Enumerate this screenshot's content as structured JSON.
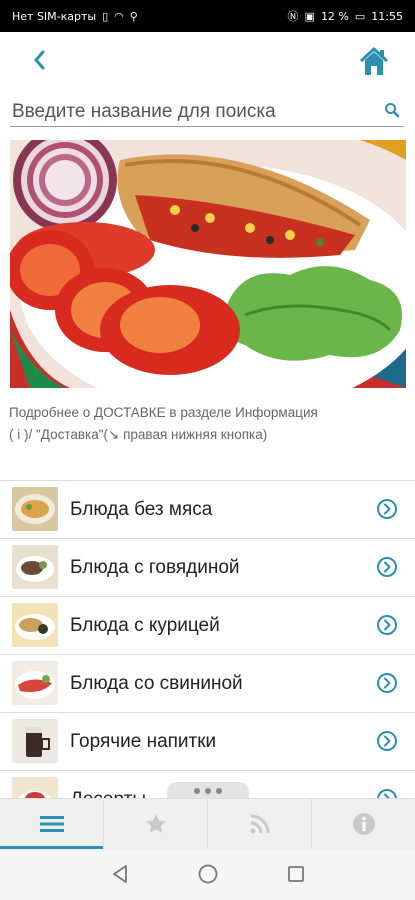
{
  "status_bar": {
    "carrier": "Нет SIM-карты",
    "battery": "12 %",
    "time": "11:55"
  },
  "header": {
    "back_icon": "chevron-left-icon",
    "home_icon": "home-icon"
  },
  "search": {
    "placeholder": "Введите название для поиска"
  },
  "banner": {
    "alt": "food-photo"
  },
  "info": {
    "line1": "Подробнее о ДОСТАВКЕ в разделе Информация",
    "line2": "( i )/ \"Доставка\"(↘ правая нижняя кнопка)"
  },
  "menu": {
    "items": [
      {
        "label": "Блюда без мяса"
      },
      {
        "label": "Блюда с говядиной"
      },
      {
        "label": "Блюда с курицей"
      },
      {
        "label": "Блюда со свининой"
      },
      {
        "label": "Горячие напитки"
      },
      {
        "label": "Десерты"
      }
    ]
  },
  "tabs": [
    {
      "icon": "menu-icon",
      "active": true
    },
    {
      "icon": "star-icon",
      "active": false
    },
    {
      "icon": "rss-icon",
      "active": false
    },
    {
      "icon": "info-icon",
      "active": false
    }
  ],
  "colors": {
    "accent": "#2a8fb0",
    "status_bar": "#000000",
    "tab_bar": "#efefef"
  }
}
